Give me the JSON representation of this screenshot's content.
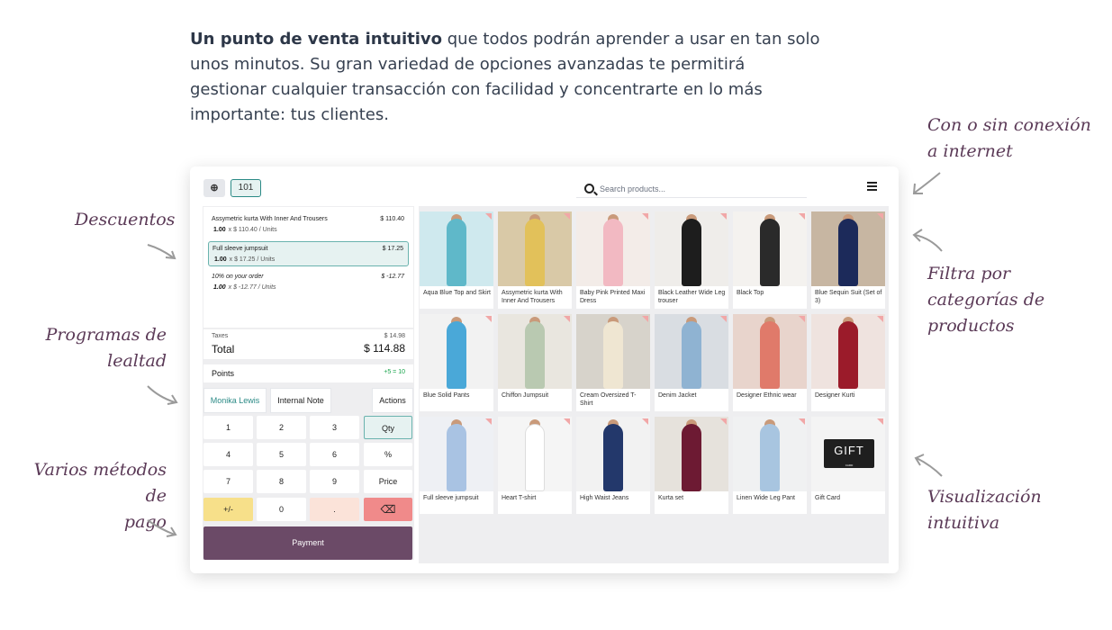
{
  "intro": {
    "bold": "Un punto de venta intuitivo",
    "rest": " que todos podrán aprender a usar en tan solo unos minutos. Su gran variedad de opciones avanzadas te permitirá gestionar cualquier transacción con facilidad y concentrarte en lo más importante: tus clientes."
  },
  "notes": {
    "discounts": "Descuentos",
    "loyalty_1": "Programas de",
    "loyalty_2": "lealtad",
    "payment_1": "Varios métodos de",
    "payment_2": "pago",
    "offline_1": "Con o sin conexión",
    "offline_2": "a internet",
    "filter_1": "Filtra por",
    "filter_2": "categorías de",
    "filter_3": "productos",
    "visual_1": "Visualización",
    "visual_2": "intuitiva"
  },
  "toolbar": {
    "plus_icon": "plus-circle-icon",
    "table": "101",
    "search_placeholder": "Search products...",
    "menu_icon": "hamburger-menu-icon"
  },
  "order": {
    "lines": [
      {
        "name": "Assymetric kurta With Inner And Trousers",
        "price": "$ 110.40",
        "qty": "1.00",
        "unit": "x $ 110.40 / Units",
        "selected": false
      },
      {
        "name": "Full sleeve jumpsuit",
        "price": "$ 17.25",
        "qty": "1.00",
        "unit": "x $ 17.25 / Units",
        "selected": true
      },
      {
        "name": "10% on your order",
        "price": "$ -12.77",
        "qty": "1.00",
        "unit": "x $ -12.77 / Units",
        "selected": false
      }
    ],
    "taxes_label": "Taxes",
    "taxes_value": "$ 14.98",
    "total_label": "Total",
    "total_value": "$ 114.88",
    "points_label": "Points",
    "points_value": "+5 = 10",
    "customer": "Monika Lewis",
    "internal_note": "Internal Note",
    "actions": "Actions",
    "payment": "Payment"
  },
  "keypad": [
    "1",
    "2",
    "3",
    "Qty",
    "4",
    "5",
    "6",
    "%",
    "7",
    "8",
    "9",
    "Price",
    "+/-",
    "0",
    ".",
    "⌫"
  ],
  "products": [
    {
      "name": "Aqua Blue Top and Skirt",
      "bg": "#cfe9ee",
      "fig": "#5fb8c9"
    },
    {
      "name": "Assymetric kurta With Inner And Trousers",
      "bg": "#d9c9a7",
      "fig": "#e2c15a"
    },
    {
      "name": "Baby Pink Printed Maxi Dress",
      "bg": "#f3ece8",
      "fig": "#f2b9c2"
    },
    {
      "name": "Black Leather Wide Leg trouser",
      "bg": "#efedea",
      "fig": "#1d1d1d"
    },
    {
      "name": "Black Top",
      "bg": "#f4f2ef",
      "fig": "#2a2a2a"
    },
    {
      "name": "Blue Sequin Suit (Set of 3)",
      "bg": "#c7b6a2",
      "fig": "#1c2a5a"
    },
    {
      "name": "Blue Solid Pants",
      "bg": "#f2f2f2",
      "fig": "#4aa8d8"
    },
    {
      "name": "Chiffon Jumpsuit",
      "bg": "#e9e6df",
      "fig": "#b9c9b1"
    },
    {
      "name": "Cream Oversized T-Shirt",
      "bg": "#d7d3cb",
      "fig": "#efe6d2"
    },
    {
      "name": "Denim Jacket",
      "bg": "#d9dde2",
      "fig": "#8fb3d2"
    },
    {
      "name": "Designer Ethnic wear",
      "bg": "#e8d4cc",
      "fig": "#e07a6a"
    },
    {
      "name": "Designer Kurti",
      "bg": "#efe3df",
      "fig": "#9b1b2a"
    },
    {
      "name": "Full sleeve jumpsuit",
      "bg": "#eef0f4",
      "fig": "#a9c3e3"
    },
    {
      "name": "Heart T-shirt",
      "bg": "#f5f5f5",
      "fig": "#ffffff"
    },
    {
      "name": "High Waist Jeans",
      "bg": "#f2f2f2",
      "fig": "#23386b"
    },
    {
      "name": "Kurta set",
      "bg": "#e6e2dc",
      "fig": "#6d1a33"
    },
    {
      "name": "Linen Wide Leg Pant",
      "bg": "#f0f1f2",
      "fig": "#a8c5e0"
    },
    {
      "name": "Gift Card",
      "bg": "#f4f4f4",
      "fig": "",
      "logo": "GIFT",
      "logo_sub": "CARD"
    }
  ],
  "colors": {
    "accent": "#2b8a86",
    "payment": "#6b4a67",
    "annotation": "#5b3a57",
    "backspace": "#f08a8a",
    "sign": "#f7e08a",
    "decimal": "#fbe3d9"
  }
}
